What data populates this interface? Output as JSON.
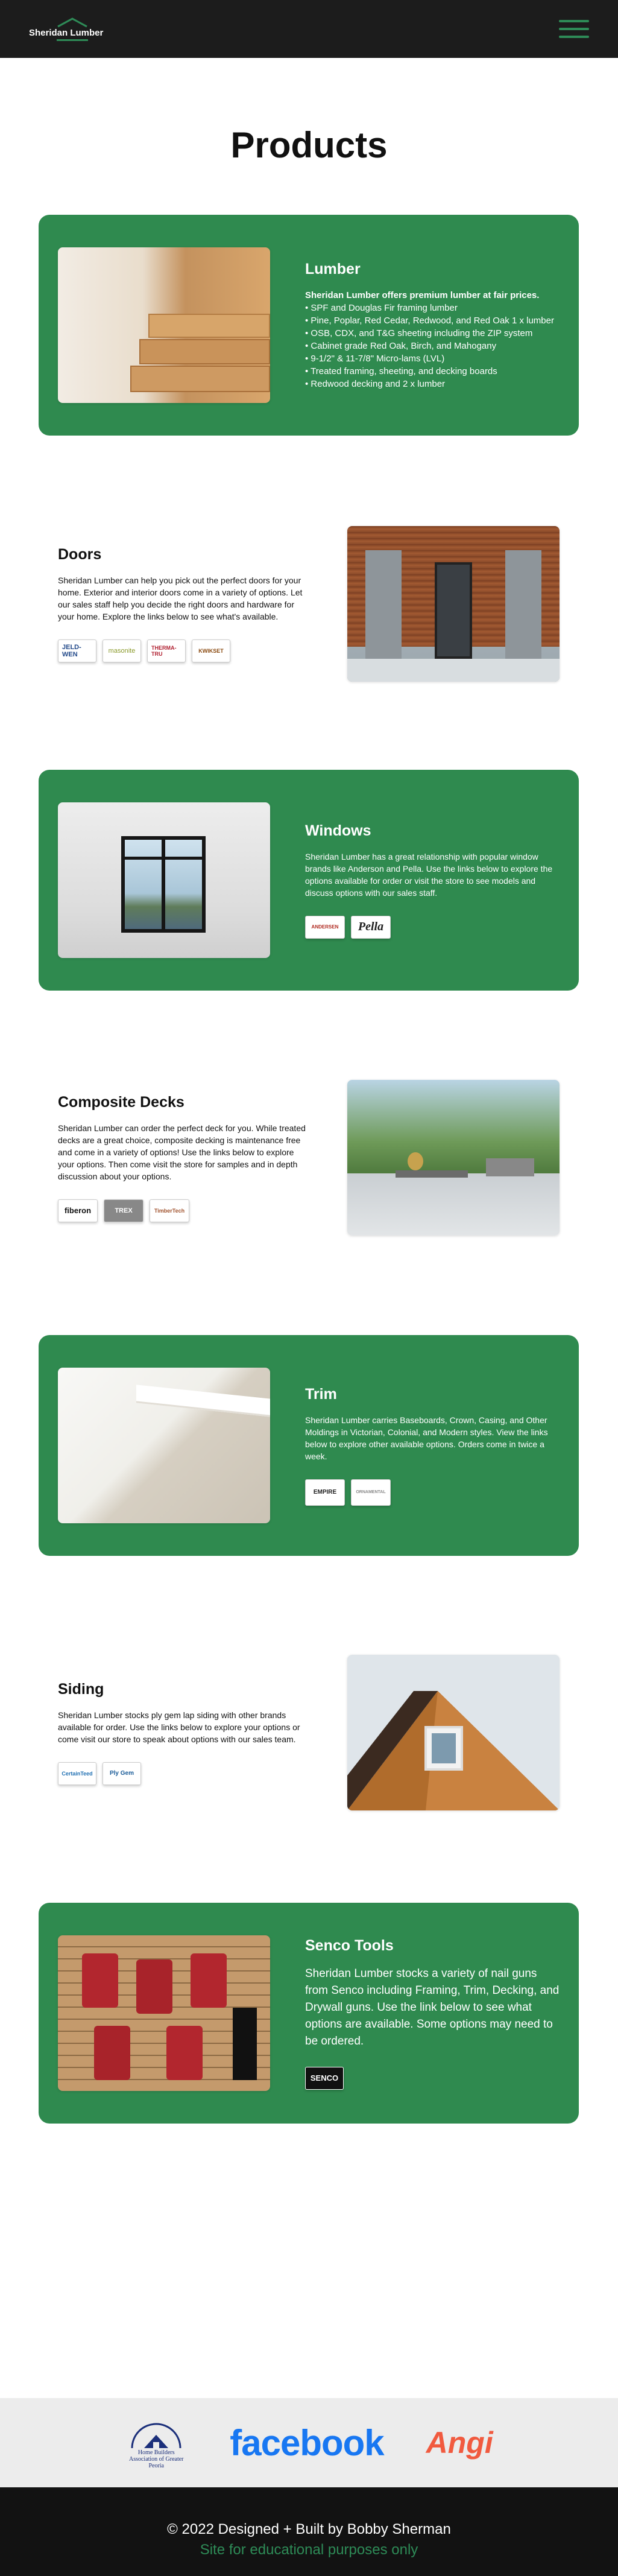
{
  "header": {
    "logo_text": "Sheridan Lumber",
    "menu_icon": "hamburger-icon",
    "accent": "#2e8b57"
  },
  "page": {
    "title": "Products"
  },
  "sections": {
    "lumber": {
      "title": "Lumber",
      "intro": "Sheridan Lumber offers premium lumber at fair prices.",
      "items": [
        "• SPF and Douglas Fir framing lumber",
        "• Pine, Poplar, Red Cedar, Redwood, and Red Oak 1 x lumber",
        "• OSB, CDX, and T&G sheeting including the ZIP system",
        "• Cabinet grade Red Oak, Birch, and Mahogany",
        "• 9-1/2\" & 11-7/8\" Micro-lams (LVL)",
        "• Treated framing, sheeting, and decking boards",
        "• Redwood decking and 2 x lumber"
      ]
    },
    "doors": {
      "title": "Doors",
      "text": "Sheridan Lumber can help you pick out the perfect doors for your home. Exterior and interior doors come in a variety of options. Let our sales staff help you decide the right doors and hardware for your home. Explore the links below to see what's available.",
      "brands": [
        "JELD-WEN",
        "masonite",
        "THERMA-TRU",
        "KWIKSET"
      ]
    },
    "windows": {
      "title": "Windows",
      "text": "Sheridan Lumber has a great relationship with popular window brands like Anderson and Pella. Use the links below to explore the options available for order or visit the store to see models and discuss options with our sales staff.",
      "brands": [
        "ANDERSEN",
        "Pella"
      ]
    },
    "decks": {
      "title": "Composite Decks",
      "text": "Sheridan Lumber can order the perfect deck for you. While treated decks are a great choice, composite decking is maintenance free and come in a variety of options! Use the links below to explore your options. Then come visit the store for samples and in depth discussion about your options.",
      "brands": [
        "fiberon",
        "TREX",
        "TimberTech"
      ]
    },
    "trim": {
      "title": "Trim",
      "text": "Sheridan Lumber carries Baseboards, Crown, Casing, and Other Moldings in Victorian, Colonial, and Modern styles. View the links below to explore other available options. Orders come in twice a week.",
      "brands": [
        "EMPIRE",
        "ORNAMENTAL"
      ]
    },
    "siding": {
      "title": "Siding",
      "text": "Sheridan Lumber stocks ply gem lap siding with other brands available for order. Use the links below to explore your options or come visit our store to speak about options with our sales team.",
      "brands": [
        "CertainTeed",
        "Ply Gem"
      ]
    },
    "senco": {
      "title": "Senco Tools",
      "text": "Sheridan Lumber stocks a variety of nail guns from Senco including Framing, Trim, Decking, and Drywall guns. Use the link below to see what options are available. Some options may need to be ordered.",
      "brands": [
        "SENCO"
      ]
    }
  },
  "footer_logos": {
    "hba": "Home Builders Association of Greater Peoria",
    "facebook": "facebook",
    "angi": "Angi"
  },
  "footer": {
    "credit": "© 2022 Designed + Built by Bobby Sherman",
    "note": "Site for educational purposes only"
  },
  "colors": {
    "green": "#2f8a4f",
    "dark": "#1c1c1c",
    "footer_bg": "#121212"
  }
}
